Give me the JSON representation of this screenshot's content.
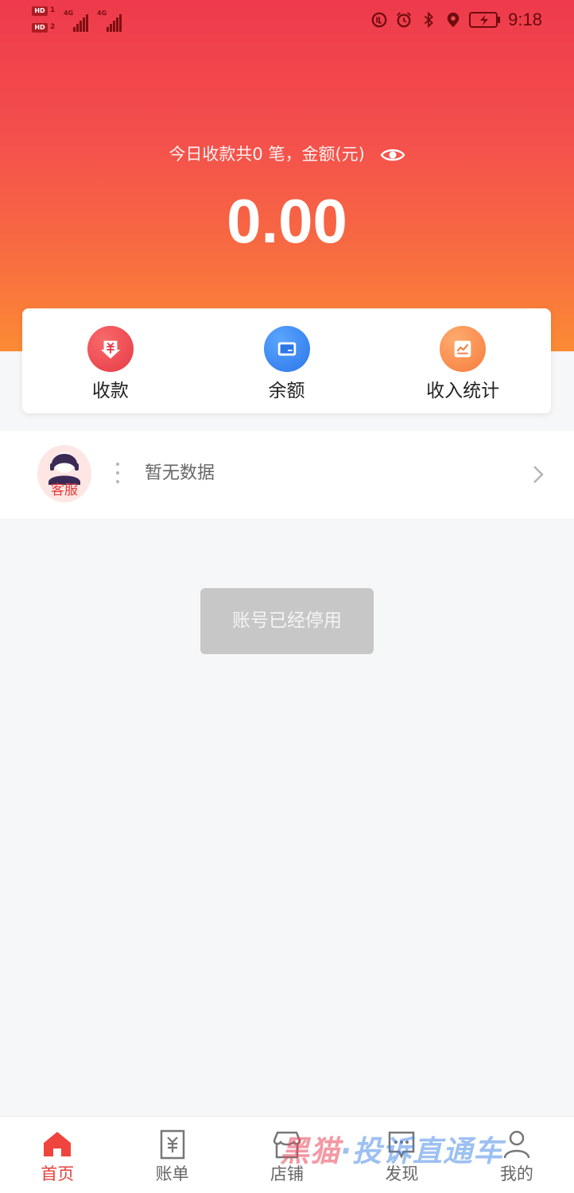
{
  "status_bar": {
    "hd1": "HD",
    "hd1_num": "1",
    "hd2": "HD",
    "hd2_num": "2",
    "net1": "4G",
    "net2": "4G",
    "time": "9:18"
  },
  "summary": {
    "text": "今日收款共0 笔，金额(元)",
    "amount": "0.00"
  },
  "actions": [
    {
      "label": "收款",
      "icon": "yuan-down-icon",
      "color": "#e63a46"
    },
    {
      "label": "余额",
      "icon": "wallet-icon",
      "color": "#2c76e8"
    },
    {
      "label": "收入统计",
      "icon": "chart-icon",
      "color": "#f57d3e"
    }
  ],
  "service": {
    "avatar_label": "客服",
    "notice": "暂无数据"
  },
  "toast": {
    "text": "账号已经停用"
  },
  "bottom_nav": [
    {
      "label": "首页",
      "icon": "home-icon",
      "active": true
    },
    {
      "label": "账单",
      "icon": "bill-icon",
      "active": false
    },
    {
      "label": "店铺",
      "icon": "store-icon",
      "active": false
    },
    {
      "label": "发现",
      "icon": "discover-icon",
      "active": false
    },
    {
      "label": "我的",
      "icon": "user-icon",
      "active": false
    }
  ],
  "watermark": {
    "part1": "黑猫",
    "part2": "·投诉直通车"
  },
  "colors": {
    "header_top": "#ee3a4c",
    "header_bottom": "#fb8b34",
    "accent": "#e8413c"
  }
}
